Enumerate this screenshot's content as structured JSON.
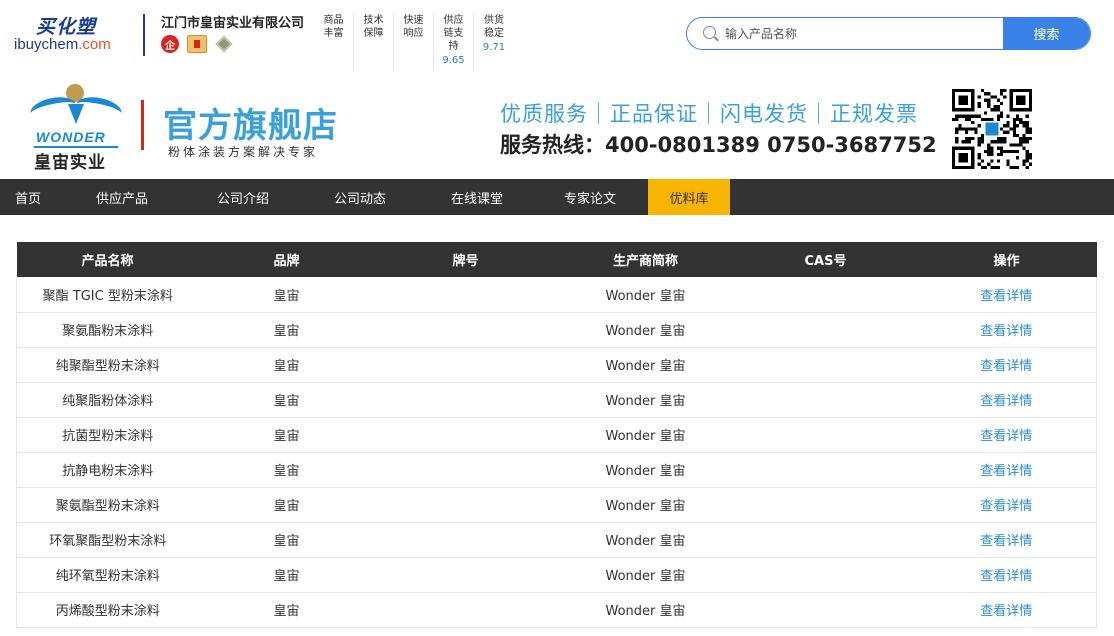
{
  "site": {
    "logo_cn": "买化塑",
    "logo_en_prefix": "ibuy",
    "logo_en_mid": "chem",
    "logo_en_suffix": ".com"
  },
  "company": {
    "name": "江门市皇宙实业有限公司",
    "badge_enterprise": "企"
  },
  "guarantees": [
    {
      "text": "商品丰富",
      "score": ""
    },
    {
      "text": "技术保障",
      "score": ""
    },
    {
      "text": "快速响应",
      "score": ""
    },
    {
      "text": "供应链支持",
      "score": "9.65"
    },
    {
      "text": "供货稳定",
      "score": "9.71"
    }
  ],
  "search": {
    "placeholder": "输入产品名称",
    "value": "",
    "button_label": "搜索"
  },
  "banner": {
    "brand_en": "WONDER",
    "brand_cn": "皇宙实业",
    "store_title": "官方旗舰店",
    "store_subtitle": "粉体涂装方案解决专家",
    "slogan": "优质服务｜正品保证｜闪电发货｜正规发票",
    "hotline": "服务热线：400-0801389 0750-3687752"
  },
  "nav": {
    "items": [
      {
        "label": "首页",
        "active": false
      },
      {
        "label": "供应产品",
        "active": false
      },
      {
        "label": "公司介绍",
        "active": false
      },
      {
        "label": "公司动态",
        "active": false
      },
      {
        "label": "在线课堂",
        "active": false
      },
      {
        "label": "专家论文",
        "active": false
      },
      {
        "label": "优料库",
        "active": true
      }
    ]
  },
  "table": {
    "headers": [
      "产品名称",
      "品牌",
      "牌号",
      "生产商简称",
      "CAS号",
      "操作"
    ],
    "rows": [
      {
        "name": "聚酯 TGIC 型粉末涂料",
        "brand": "皇宙",
        "grade": "",
        "maker": "Wonder 皇宙",
        "cas": "",
        "action": "查看详情"
      },
      {
        "name": "聚氨酯粉末涂料",
        "brand": "皇宙",
        "grade": "",
        "maker": "Wonder 皇宙",
        "cas": "",
        "action": "查看详情"
      },
      {
        "name": "纯聚酯型粉末涂料",
        "brand": "皇宙",
        "grade": "",
        "maker": "Wonder 皇宙",
        "cas": "",
        "action": "查看详情"
      },
      {
        "name": "纯聚脂粉体涂料",
        "brand": "皇宙",
        "grade": "",
        "maker": "Wonder 皇宙",
        "cas": "",
        "action": "查看详情"
      },
      {
        "name": "抗菌型粉末涂料",
        "brand": "皇宙",
        "grade": "",
        "maker": "Wonder 皇宙",
        "cas": "",
        "action": "查看详情"
      },
      {
        "name": "抗静电粉末涂料",
        "brand": "皇宙",
        "grade": "",
        "maker": "Wonder 皇宙",
        "cas": "",
        "action": "查看详情"
      },
      {
        "name": "聚氨酯型粉末涂料",
        "brand": "皇宙",
        "grade": "",
        "maker": "Wonder 皇宙",
        "cas": "",
        "action": "查看详情"
      },
      {
        "name": "环氧聚酯型粉末涂料",
        "brand": "皇宙",
        "grade": "",
        "maker": "Wonder 皇宙",
        "cas": "",
        "action": "查看详情"
      },
      {
        "name": "纯环氧型粉末涂料",
        "brand": "皇宙",
        "grade": "",
        "maker": "Wonder 皇宙",
        "cas": "",
        "action": "查看详情"
      },
      {
        "name": "丙烯酸型粉末涂料",
        "brand": "皇宙",
        "grade": "",
        "maker": "Wonder 皇宙",
        "cas": "",
        "action": "查看详情"
      }
    ]
  },
  "colors": {
    "accent_blue": "#3b82e8",
    "nav_bg": "#333333",
    "nav_active": "#f7b500",
    "link": "#2b8cd6",
    "brand_blue": "#3aa0dc"
  }
}
